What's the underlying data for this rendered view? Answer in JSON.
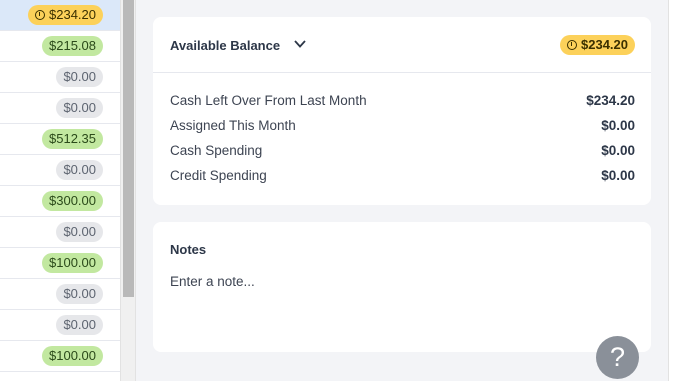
{
  "left_list": {
    "rows": [
      {
        "amount": "$234.20",
        "style": "yellow",
        "selected": true
      },
      {
        "amount": "$215.08",
        "style": "green"
      },
      {
        "amount": "$0.00",
        "style": "grey"
      },
      {
        "amount": "$0.00",
        "style": "grey"
      },
      {
        "amount": "$512.35",
        "style": "green"
      },
      {
        "amount": "$0.00",
        "style": "grey"
      },
      {
        "amount": "$300.00",
        "style": "green"
      },
      {
        "amount": "$0.00",
        "style": "grey"
      },
      {
        "amount": "$100.00",
        "style": "green"
      },
      {
        "amount": "$0.00",
        "style": "grey"
      },
      {
        "amount": "$0.00",
        "style": "grey"
      },
      {
        "amount": "$100.00",
        "style": "green"
      }
    ]
  },
  "balance_card": {
    "title": "Available Balance",
    "amount": "$234.20",
    "rows": [
      {
        "label": "Cash Left Over From Last Month",
        "value": "$234.20"
      },
      {
        "label": "Assigned This Month",
        "value": "$0.00"
      },
      {
        "label": "Cash Spending",
        "value": "$0.00"
      },
      {
        "label": "Credit Spending",
        "value": "$0.00"
      }
    ]
  },
  "notes_card": {
    "title": "Notes",
    "placeholder": "Enter a note..."
  },
  "help_button": {
    "label": "?"
  },
  "colors": {
    "accent_yellow": "#fcd15a",
    "funded_green": "#c2e8a0",
    "zero_grey": "#e6e7ea",
    "selected_row": "#dbe8f9"
  }
}
